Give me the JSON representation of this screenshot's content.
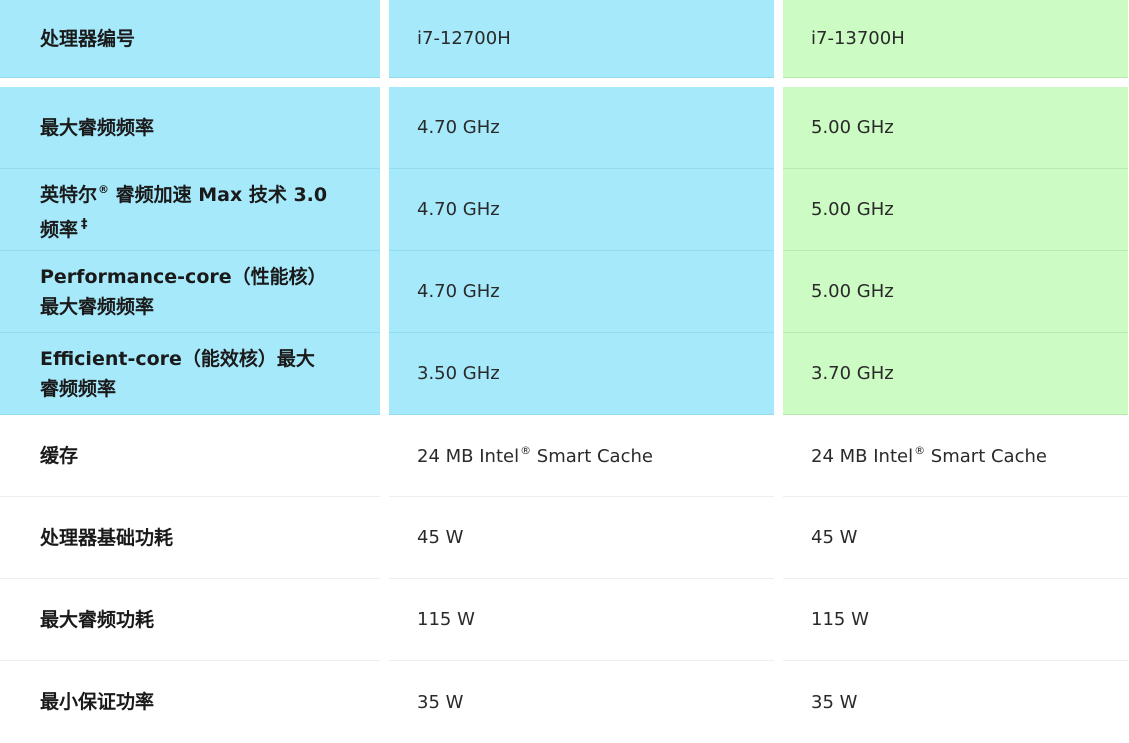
{
  "rows": [
    {
      "label": "处理器编号",
      "a": "i7-12700H",
      "b": "i7-13700H"
    },
    {
      "label": "最大睿频频率",
      "a": "4.70 GHz",
      "b": "5.00 GHz"
    },
    {
      "label_line1": "英特尔",
      "label_line1_sup": "®",
      "label_line1_rest": " 睿频加速 Max 技术 3.0",
      "label_line2": "频率",
      "label_line2_sup": "‡",
      "a": "4.70 GHz",
      "b": "5.00 GHz"
    },
    {
      "label_line1": "Performance-core（性能核）",
      "label_line2": "最大睿频频率",
      "a": "4.70 GHz",
      "b": "5.00 GHz"
    },
    {
      "label_line1": "Efficient-core（能效核）最大",
      "label_line2": "睿频频率",
      "a": "3.50 GHz",
      "b": "3.70 GHz"
    },
    {
      "label": "缓存",
      "a_pre": "24 MB Intel",
      "a_sup": "®",
      "a_post": " Smart Cache",
      "b_pre": "24 MB Intel",
      "b_sup": "®",
      "b_post": " Smart Cache"
    },
    {
      "label": "处理器基础功耗",
      "a": "45 W",
      "b": "45 W"
    },
    {
      "label": "最大睿频功耗",
      "a": "115 W",
      "b": "115 W"
    },
    {
      "label": "最小保证功率",
      "a": "35 W",
      "b": "35 W"
    }
  ],
  "colors": {
    "first_col_bg": "#a6e9fb",
    "i7_12700H_bg": "#a6e9fb",
    "i7_13700H_bg": "#ccfbc3",
    "plain_bg": "#ffffff"
  }
}
